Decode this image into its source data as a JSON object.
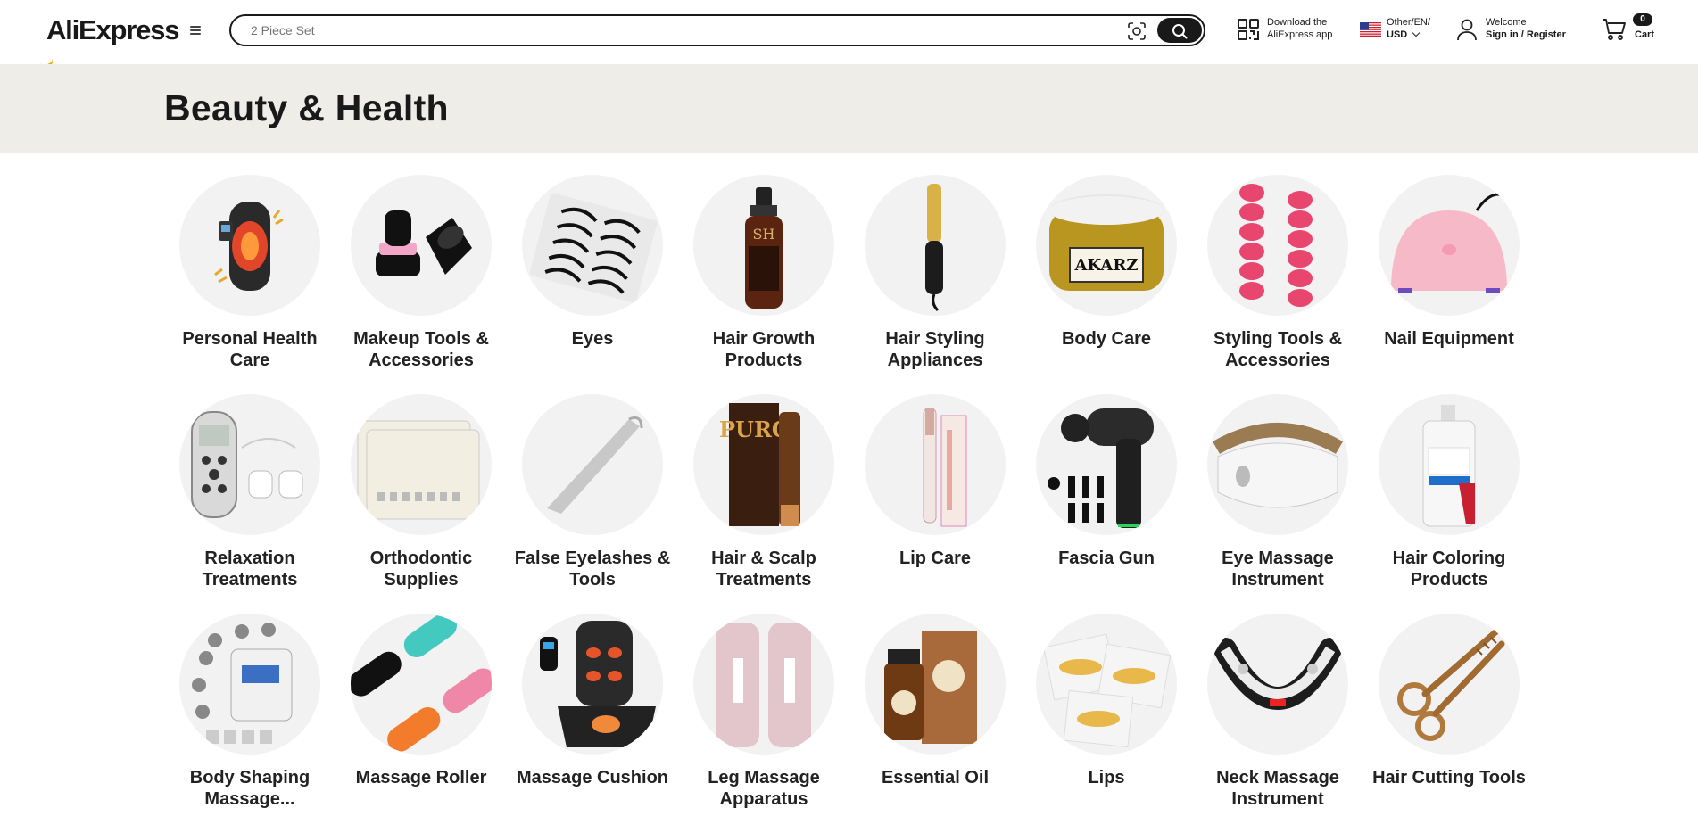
{
  "header": {
    "logo_text": "AliExpress",
    "search": {
      "placeholder": "2 Piece Set"
    },
    "app_download": {
      "line1": "Download the",
      "line2": "AliExpress app"
    },
    "locale": {
      "line1": "Other/EN/",
      "currency": "USD"
    },
    "account": {
      "line1": "Welcome",
      "line2": "Sign in / Register"
    },
    "cart": {
      "count": "0",
      "label": "Cart"
    },
    "brand_accent": "#f7a600"
  },
  "page": {
    "title": "Beauty & Health"
  },
  "categories": [
    {
      "label": "Personal Health Care",
      "icon": "knee-brace-icon"
    },
    {
      "label": "Makeup Tools & Accessories",
      "icon": "makeup-sponge-holder-icon"
    },
    {
      "label": "Eyes",
      "icon": "false-lashes-tray-icon"
    },
    {
      "label": "Hair Growth Products",
      "icon": "spray-bottle-icon"
    },
    {
      "label": "Hair Styling Appliances",
      "icon": "hot-comb-icon"
    },
    {
      "label": "Body Care",
      "icon": "butter-jar-icon"
    },
    {
      "label": "Styling Tools & Accessories",
      "icon": "hair-rollers-icon"
    },
    {
      "label": "Nail Equipment",
      "icon": "nail-lamp-icon"
    },
    {
      "label": "Relaxation Treatments",
      "icon": "tens-device-icon"
    },
    {
      "label": "Orthodontic Supplies",
      "icon": "bracket-kits-icon"
    },
    {
      "label": "False Eyelashes & Tools",
      "icon": "lash-tweezers-icon"
    },
    {
      "label": "Hair & Scalp Treatments",
      "icon": "scalp-treatment-box-icon"
    },
    {
      "label": "Lip Care",
      "icon": "lip-gloss-icon"
    },
    {
      "label": "Fascia Gun",
      "icon": "massage-gun-icon"
    },
    {
      "label": "Eye Massage Instrument",
      "icon": "eye-massager-icon"
    },
    {
      "label": "Hair Coloring Products",
      "icon": "developer-bottle-icon"
    },
    {
      "label": "Body Shaping Massage...",
      "icon": "slimming-machine-icon"
    },
    {
      "label": "Massage Roller",
      "icon": "foam-rollers-icon"
    },
    {
      "label": "Massage Cushion",
      "icon": "seat-massager-icon"
    },
    {
      "label": "Leg Massage Apparatus",
      "icon": "leg-compression-icon"
    },
    {
      "label": "Essential Oil",
      "icon": "oil-bottle-box-icon"
    },
    {
      "label": "Lips",
      "icon": "gold-lip-masks-icon"
    },
    {
      "label": "Neck Massage Instrument",
      "icon": "neck-massager-icon"
    },
    {
      "label": "Hair Cutting Tools",
      "icon": "scissors-icon"
    }
  ]
}
